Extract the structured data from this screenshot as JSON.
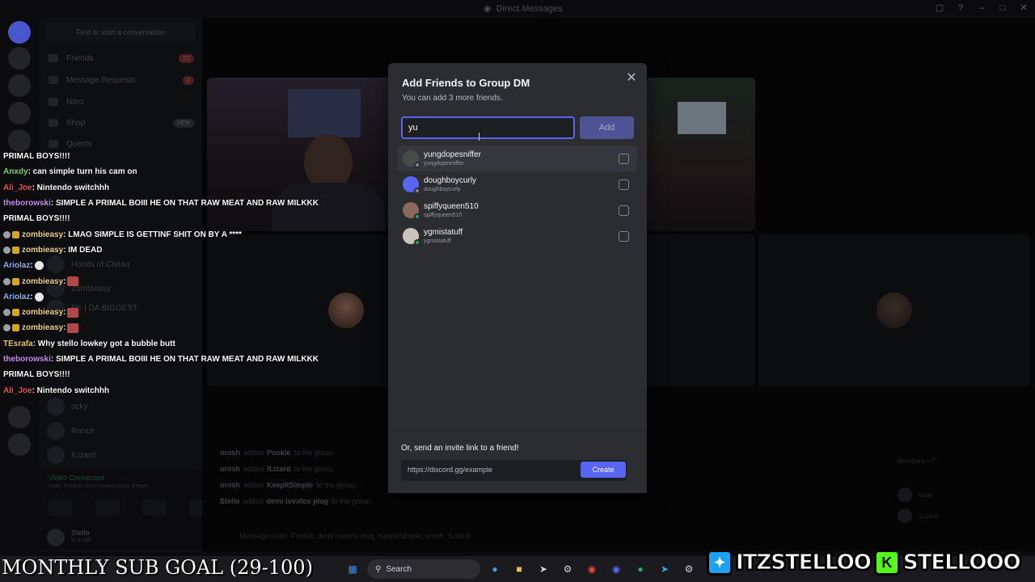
{
  "window": {
    "title": "Direct Messages"
  },
  "dm_sidebar": {
    "search_placeholder": "Find or start a conversation",
    "nav": [
      {
        "label": "Friends",
        "badge": "23"
      },
      {
        "label": "Message Requests",
        "badge": "4"
      },
      {
        "label": "Nitro",
        "badge": ""
      },
      {
        "label": "Shop",
        "badge": "NEW"
      },
      {
        "label": "Quests",
        "badge": ""
      }
    ],
    "dms": [
      {
        "label": "Hoods of Chiraq"
      },
      {
        "label": "Zombieasy"
      },
      {
        "label": "PE | DA BIGGEST"
      },
      {
        "label": "ocky"
      },
      {
        "label": "Rance"
      },
      {
        "label": "!Lizard"
      }
    ],
    "voice": {
      "title": "Video Connected",
      "sub": "noah, Pookie, demi lovatos plug, KeepIt..."
    },
    "user": {
      "name": "Stello",
      "status": "In a call"
    }
  },
  "call": {
    "system_messages": [
      {
        "actor": "urosh",
        "action": "added",
        "target": "Pookie",
        "rest": "to the group."
      },
      {
        "actor": "urosh",
        "action": "added",
        "target": "!Lizard",
        "rest": "to the group."
      },
      {
        "actor": "urosh",
        "action": "added",
        "target": "KeepItSimple",
        "rest": "to the group."
      },
      {
        "actor": "Stello",
        "action": "added",
        "target": "demi lovatos plug",
        "rest": "to the group."
      }
    ],
    "message_placeholder": "Message noah, Pookie, demi lovatos plug, KeepItSimple, urosh, !Lizard",
    "members_header": "Members—7",
    "members": [
      "noah",
      "!Lizard"
    ]
  },
  "modal": {
    "title": "Add Friends to Group DM",
    "subtitle": "You can add 3 more friends.",
    "input_value": "yu",
    "add_label": "Add",
    "friends": [
      {
        "display": "yungdopesniffer",
        "username": "yungdopesniffer",
        "online": false,
        "avatar_color": "#4a4a4a"
      },
      {
        "display": "doughboycurly",
        "username": "doughboycurly",
        "online": false,
        "avatar_color": "#5865f2"
      },
      {
        "display": "spiffyqueen510",
        "username": "spiffyqueen510",
        "online": true,
        "avatar_color": "#8a6a5a"
      },
      {
        "display": "ygmistatuff",
        "username": "ygmistatuff",
        "online": true,
        "avatar_color": "#c9c4bc"
      }
    ],
    "invite_title": "Or, send an invite link to a friend!",
    "invite_link": "https://discord.gg/example",
    "create_label": "Create"
  },
  "stream_chat": [
    {
      "user": "",
      "color": "#ffffff",
      "text": "PRIMAL BOYS!!!!",
      "badges": 0,
      "emote": ""
    },
    {
      "user": "Anxdy",
      "color": "#7fd66b",
      "text": " : can simple turn his cam on",
      "badges": 0,
      "emote": ""
    },
    {
      "user": "Ali_Joe",
      "color": "#e05a5a",
      "text": " : Nintendo switchhh",
      "badges": 0,
      "emote": ""
    },
    {
      "user": "theborowski",
      "color": "#c98ff0",
      "text": " : SIMPLE A PRIMAL BOIII HE ON THAT RAW MEAT AND RAW MILKKK",
      "badges": 0,
      "emote": ""
    },
    {
      "user": "",
      "color": "#ffffff",
      "text": "PRIMAL BOYS!!!!",
      "badges": 0,
      "emote": ""
    },
    {
      "user": "zombieasy",
      "color": "#f2d48a",
      "text": " : LMAO SIMPLE IS GETTINF SHIT ON BY A ****",
      "badges": 2,
      "emote": ""
    },
    {
      "user": "zombieasy",
      "color": "#f2d48a",
      "text": " : IM DEAD",
      "badges": 2,
      "emote": ""
    },
    {
      "user": "Ariolaz",
      "color": "#8ab4f0",
      "text": " : ",
      "badges": 0,
      "emote": "w"
    },
    {
      "user": "zombieasy",
      "color": "#f2d48a",
      "text": " : ",
      "badges": 2,
      "emote": "r"
    },
    {
      "user": "Ariolaz",
      "color": "#8ab4f0",
      "text": " : ",
      "badges": 0,
      "emote": "w"
    },
    {
      "user": "zombieasy",
      "color": "#f2d48a",
      "text": " : ",
      "badges": 2,
      "emote": "r"
    },
    {
      "user": "zombieasy",
      "color": "#f2d48a",
      "text": " : ",
      "badges": 2,
      "emote": "r"
    },
    {
      "user": "TEsrafa",
      "color": "#f0c850",
      "text": " : Why stello lowkey got a bubble butt",
      "badges": 0,
      "emote": ""
    },
    {
      "user": "theborowski",
      "color": "#c98ff0",
      "text": " : SIMPLE A PRIMAL BOIII HE ON THAT RAW MEAT AND RAW MILKKK",
      "badges": 0,
      "emote": ""
    },
    {
      "user": "",
      "color": "#ffffff",
      "text": "PRIMAL BOYS!!!!",
      "badges": 0,
      "emote": ""
    },
    {
      "user": "Ali_Joe",
      "color": "#e05a5a",
      "text": " : Nintendo switchhh",
      "badges": 0,
      "emote": ""
    }
  ],
  "overlay": {
    "sub_goal": "MONTHLY SUB GOAL (29-100)",
    "twitter_handle": "ITZSTELLOO",
    "kick_handle": "STELLOOO"
  },
  "taskbar": {
    "search_label": "Search"
  },
  "colors": {
    "accent": "#5865f2",
    "online": "#23a559",
    "kick_green": "#53fc18",
    "twitter_blue": "#1da1f2"
  }
}
